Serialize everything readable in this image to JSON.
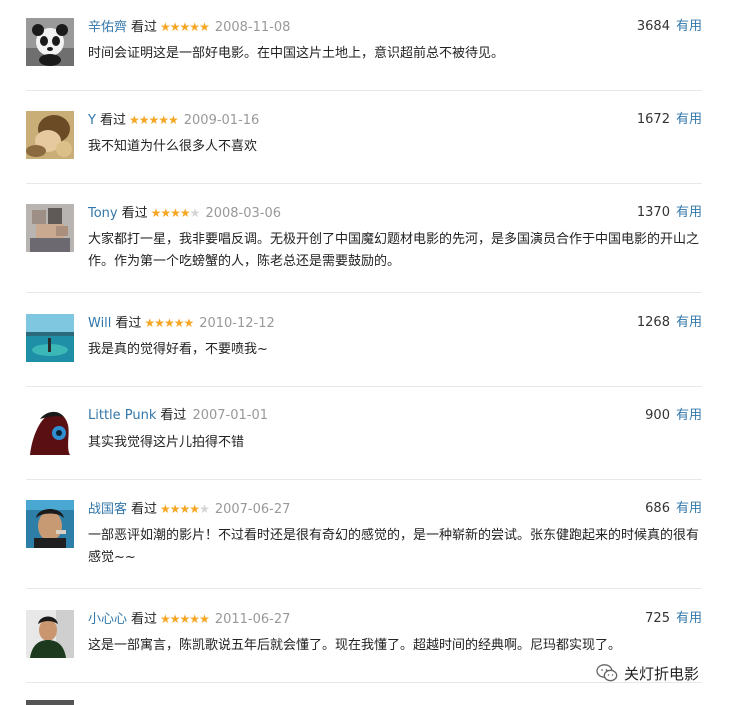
{
  "reviews": [
    {
      "user": "辛佑齊",
      "watched": "看过",
      "rating": 5,
      "date": "2008-11-08",
      "votes": "3684",
      "useful": "有用",
      "text": "时间会证明这是一部好电影。在中国这片土地上，意识超前总不被待见。"
    },
    {
      "user": "Y",
      "watched": "看过",
      "rating": 5,
      "date": "2009-01-16",
      "votes": "1672",
      "useful": "有用",
      "text": "我不知道为什么很多人不喜欢"
    },
    {
      "user": "Tony",
      "watched": "看过",
      "rating": 4,
      "date": "2008-03-06",
      "votes": "1370",
      "useful": "有用",
      "text": "大家都打一星，我非要唱反调。无极开创了中国魔幻题材电影的先河，是多国演员合作于中国电影的开山之作。作为第一个吃螃蟹的人，陈老总还是需要鼓励的。"
    },
    {
      "user": "Will",
      "watched": "看过",
      "rating": 5,
      "date": "2010-12-12",
      "votes": "1268",
      "useful": "有用",
      "text": "我是真的觉得好看，不要喷我~"
    },
    {
      "user": "Little Punk",
      "watched": "看过",
      "rating": 0,
      "date": "2007-01-01",
      "votes": "900",
      "useful": "有用",
      "text": "其实我觉得这片儿拍得不错"
    },
    {
      "user": "战国客",
      "watched": "看过",
      "rating": 4,
      "date": "2007-06-27",
      "votes": "686",
      "useful": "有用",
      "text": "一部恶评如潮的影片！不过看时还是很有奇幻的感觉的，是一种崭新的尝试。张东健跑起来的时候真的很有感觉~~"
    },
    {
      "user": "小心心",
      "watched": "看过",
      "rating": 5,
      "date": "2011-06-27",
      "votes": "725",
      "useful": "有用",
      "text": "这是一部寓言，陈凯歌说五年后就会懂了。现在我懂了。超越时间的经典啊。尼玛都实现了。"
    }
  ],
  "watermark": {
    "text": "关灯折电影",
    "icon": "wechat-icon"
  },
  "colors": {
    "link": "#3377aa",
    "star": "#f5a623",
    "star_empty": "#d4d4d4",
    "date": "#999999"
  }
}
